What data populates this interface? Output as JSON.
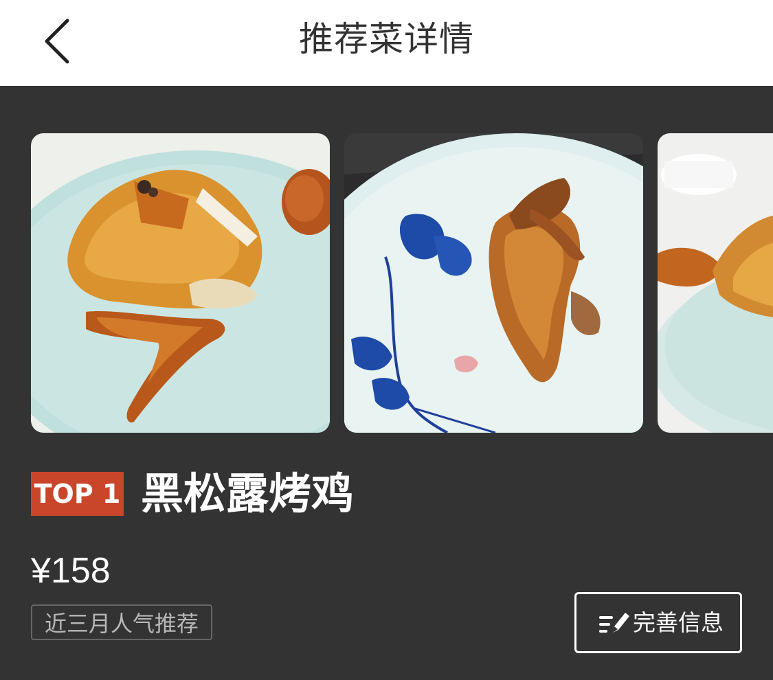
{
  "header": {
    "title": "推荐菜详情"
  },
  "gallery": {
    "photos": [
      {
        "icon": "roast-chicken-photo",
        "watermark": "©"
      },
      {
        "icon": "roast-chicken-leg-photo"
      },
      {
        "icon": "roast-chicken-partial-photo"
      }
    ]
  },
  "dish": {
    "rank": "TOP 1",
    "name": "黑松露烤鸡",
    "price": "¥158",
    "tag": "近三月人气推荐"
  },
  "actions": {
    "complete_info_label": "完善信息",
    "complete_info_icon": "edit-list-icon"
  },
  "colors": {
    "background": "#333333",
    "header_bg": "#ffffff",
    "badge": "#c9462b",
    "text": "#ffffff"
  }
}
